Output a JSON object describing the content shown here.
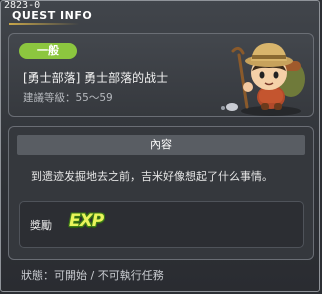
{
  "window": {
    "id": "2823-0",
    "title": "QUEST INFO"
  },
  "quest": {
    "category": "一般",
    "name": "[勇士部落] 勇士部落的战士",
    "level": "建議等級：55～59"
  },
  "content": {
    "header": "內容",
    "text": "到遗迹发掘地去之前，吉米好像想起了什么事情。"
  },
  "reward": {
    "label": "獎勵",
    "exp_icon": "EXP"
  },
  "status": {
    "text": "狀態：可開始 / 不可執行任務"
  },
  "colors": {
    "badge": "#8cc63f",
    "exp": "#e9f55a"
  }
}
